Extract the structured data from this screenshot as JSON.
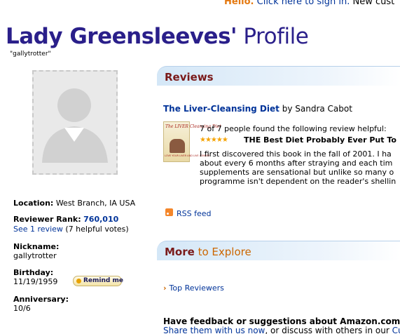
{
  "header": {
    "hello": "Hello.",
    "signin_link": "Click here to sign in.",
    "new_customer": "New cust"
  },
  "profile": {
    "name": "Lady Greensleeves'",
    "title_suffix": "Profile",
    "nickname_quoted": "\"gallytrotter\""
  },
  "info": {
    "location_label": "Location:",
    "location_value": "West Branch, IA USA",
    "rank_label": "Reviewer Rank:",
    "rank_value": "760,010",
    "see_reviews_link": "See 1 review",
    "helpful_votes": "(7 helpful votes)",
    "nickname_label": "Nickname:",
    "nickname_value": "gallytrotter",
    "birthday_label": "Birthday:",
    "birthday_value": "11/19/1959",
    "remind_button": "Remind me",
    "anniversary_label": "Anniversary:",
    "anniversary_value": "10/6"
  },
  "reviews": {
    "header": "Reviews",
    "book_title": "The Liver-Cleansing Diet",
    "book_by": "by Sandra Cabot",
    "cover_title": "The LIVER Cleansing Diet",
    "cover_subtitle": "LOVE YOUR LIVER AND LIVE LONGER",
    "helpful_line": "7 of 7 people found the following review helpful:",
    "stars": "★★★★★",
    "rating": 5,
    "headline": "THE Best Diet Probably Ever Put To",
    "text_lines": [
      "I first discovered this book in the fall of 2001. I ha",
      "about every 6 months after straying and each tim",
      "supplements are sensational but unlike so many o",
      "programme isn't dependent on the reader's shellin"
    ],
    "rss_link": "RSS feed"
  },
  "explore": {
    "header_bold": "More",
    "header_rest": "to Explore",
    "top_reviewers_link": "Top Reviewers"
  },
  "feedback": {
    "question": "Have feedback or suggestions about Amazon.com's",
    "share_link": "Share them with us now",
    "rest": ", or discuss with others in our",
    "cust_link": "Cust"
  },
  "colors": {
    "title": "#2a1f8a",
    "link": "#003399",
    "section_title": "#7a1a1a",
    "accent_orange": "#cc6600"
  }
}
